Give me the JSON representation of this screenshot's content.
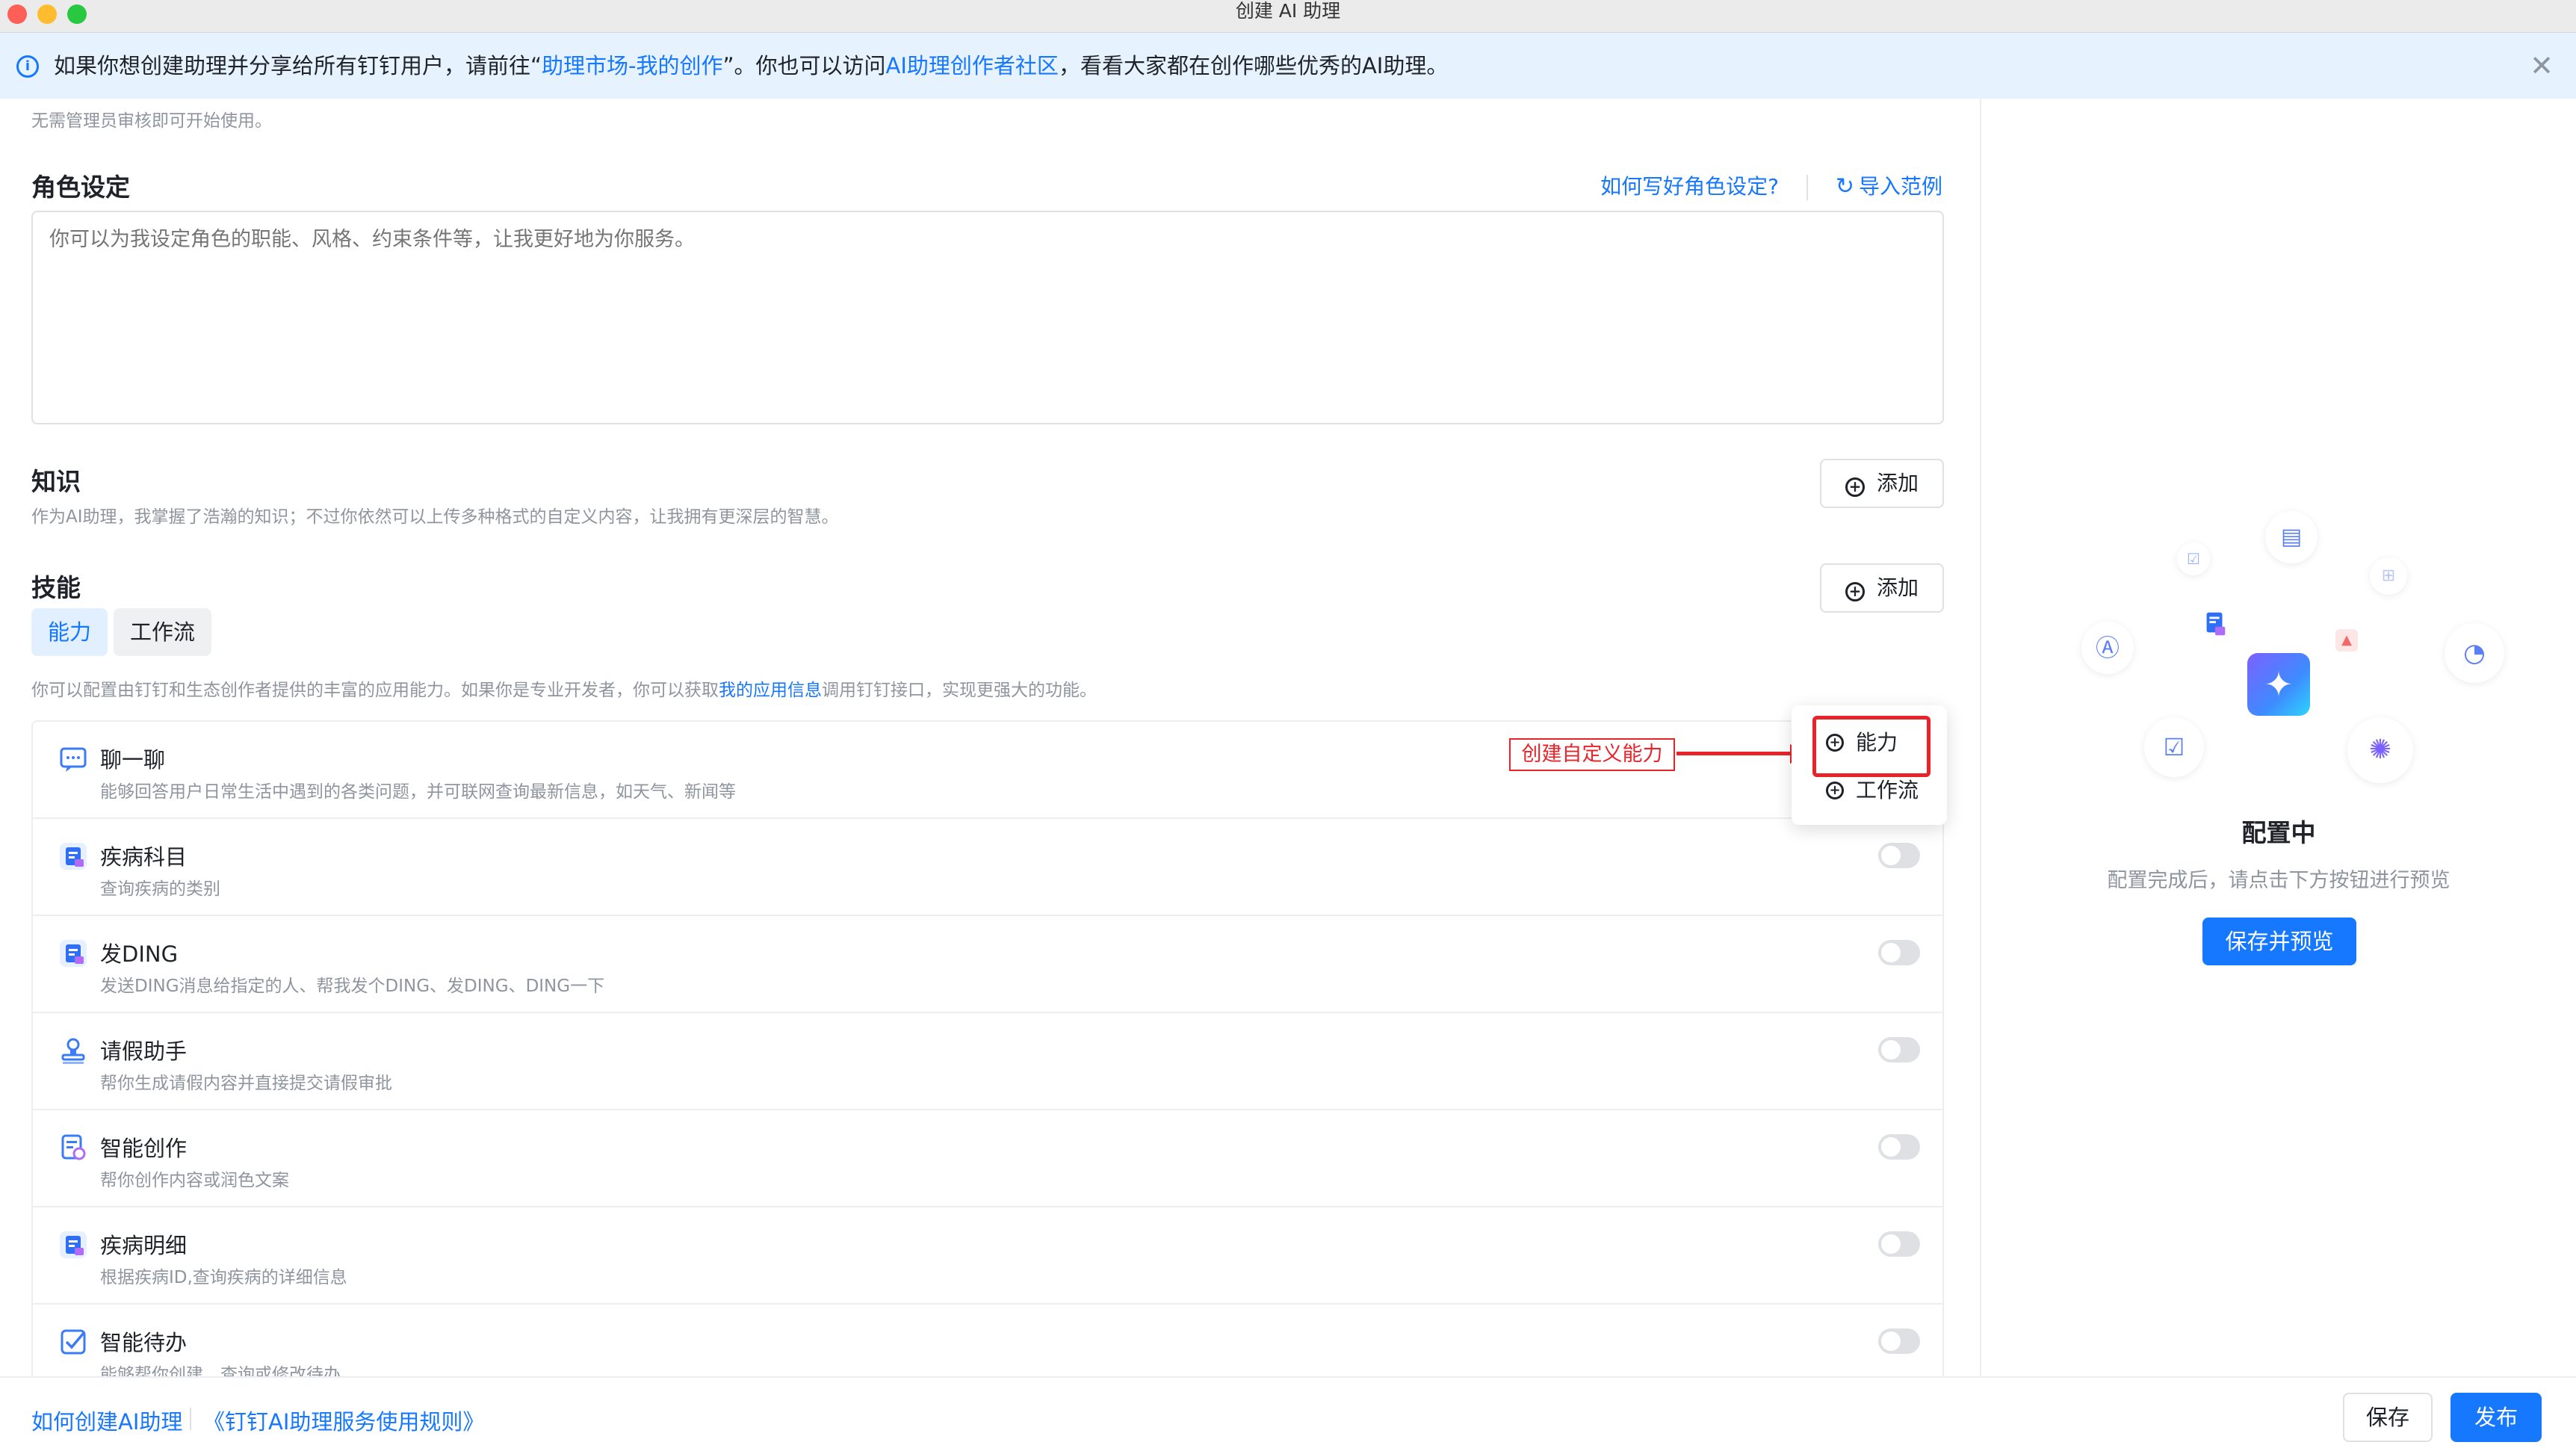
{
  "window": {
    "title": "创建 AI 助理"
  },
  "banner": {
    "text_before": "如果你想创建助理并分享给所有钉钉用户，请前往“",
    "link1": "助理市场-我的创作",
    "text_middle": "”。你也可以访问",
    "link2": "AI助理创作者社区",
    "text_after": "，看看大家都在创作哪些优秀的AI助理。"
  },
  "top_hint": "无需管理员审核即可开始使用。",
  "role": {
    "title": "角色设定",
    "help_link": "如何写好角色设定?",
    "import_link": "导入范例",
    "placeholder": "你可以为我设定角色的职能、风格、约束条件等，让我更好地为你服务。"
  },
  "knowledge": {
    "title": "知识",
    "desc": "作为AI助理，我掌握了浩瀚的知识；不过你依然可以上传多种格式的自定义内容，让我拥有更深层的智慧。",
    "add_label": "添加"
  },
  "skills": {
    "title": "技能",
    "add_label": "添加",
    "tabs": [
      "能力",
      "工作流"
    ],
    "desc_before": "你可以配置由钉钉和生态创作者提供的丰富的应用能力。如果你是专业开发者，你可以获取",
    "desc_link": "我的应用信息",
    "desc_after": "调用钉钉接口，实现更强大的功能。",
    "items": [
      {
        "name": "聊一聊",
        "desc": "能够回答用户日常生活中遇到的各类问题，并可联网查询最新信息，如天气、新闻等",
        "enabled": true,
        "icon": "chat-icon"
      },
      {
        "name": "疾病科目",
        "desc": "查询疾病的类别",
        "enabled": false,
        "icon": "doc-app-icon"
      },
      {
        "name": "发DING",
        "desc": "发送DING消息给指定的人、帮我发个DING、发DING、DING一下",
        "enabled": false,
        "icon": "doc-app-icon"
      },
      {
        "name": "请假助手",
        "desc": "帮你生成请假内容并直接提交请假审批",
        "enabled": false,
        "icon": "stamp-icon"
      },
      {
        "name": "智能创作",
        "desc": "帮你创作内容或润色文案",
        "enabled": false,
        "icon": "writing-icon"
      },
      {
        "name": "疾病明细",
        "desc": "根据疾病ID,查询疾病的详细信息",
        "enabled": false,
        "icon": "doc-app-icon"
      },
      {
        "name": "智能待办",
        "desc": "能够帮你创建、查询或修改待办",
        "enabled": false,
        "icon": "todo-check-icon"
      }
    ]
  },
  "dropdown": {
    "items": [
      "能力",
      "工作流"
    ]
  },
  "annotation": {
    "label": "创建自定义能力"
  },
  "preview_panel": {
    "title": "配置中",
    "desc": "配置完成后，请点击下方按钮进行预览",
    "button": "保存并预览"
  },
  "footer": {
    "link1": "如何创建AI助理",
    "link2": "《钉钉AI助理服务使用规则》",
    "save": "保存",
    "publish": "发布"
  },
  "colors": {
    "accent": "#1677ff",
    "annotation": "#e8232a",
    "banner_bg": "#e6f2fd"
  }
}
